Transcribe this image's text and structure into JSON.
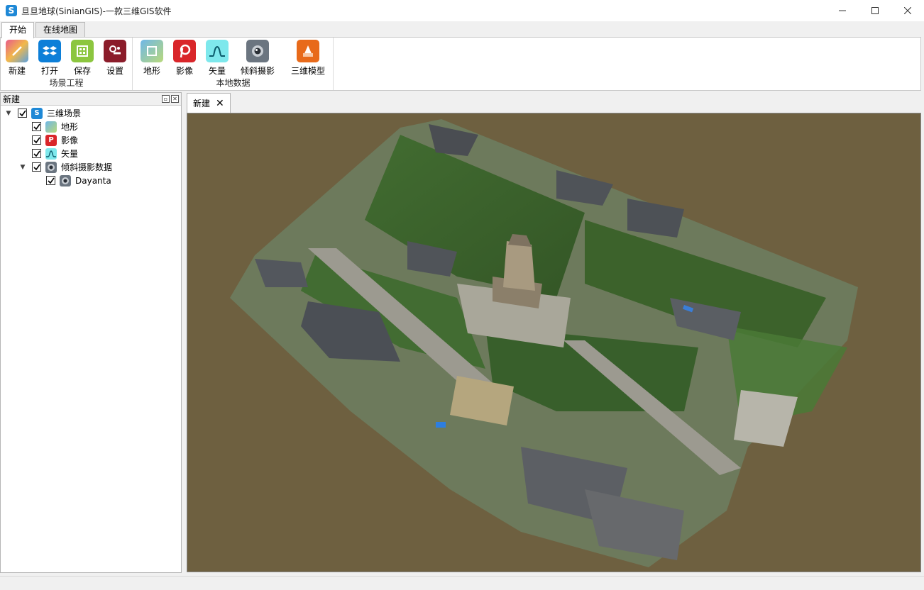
{
  "window": {
    "title": "旦旦地球(SinianGIS)-一款三维GIS软件",
    "app_icon": "S"
  },
  "ribbon_tabs": [
    {
      "label": "开始",
      "active": true
    },
    {
      "label": "在线地图",
      "active": false
    }
  ],
  "ribbon": {
    "groups": [
      {
        "label": "场景工程",
        "buttons": [
          {
            "label": "新建",
            "icon": "new-scene-icon"
          },
          {
            "label": "打开",
            "icon": "open-dropbox-icon"
          },
          {
            "label": "保存",
            "icon": "save-icon"
          },
          {
            "label": "设置",
            "icon": "settings-icon"
          }
        ]
      },
      {
        "label": "本地数据",
        "buttons": [
          {
            "label": "地形",
            "icon": "terrain-icon"
          },
          {
            "label": "影像",
            "icon": "imagery-icon"
          },
          {
            "label": "矢量",
            "icon": "vector-icon"
          },
          {
            "label": "倾斜摄影",
            "icon": "oblique-photo-icon"
          },
          {
            "label": "三维模型",
            "icon": "3d-model-icon"
          }
        ]
      }
    ]
  },
  "left_panel": {
    "title": "新建",
    "tree": [
      {
        "label": "三维场景",
        "level": 0,
        "expanded": true,
        "checked": true,
        "icon": "scene-icon"
      },
      {
        "label": "地形",
        "level": 1,
        "checked": true,
        "icon": "terrain-icon"
      },
      {
        "label": "影像",
        "level": 1,
        "checked": true,
        "icon": "imagery-icon"
      },
      {
        "label": "矢量",
        "level": 1,
        "checked": true,
        "icon": "vector-icon"
      },
      {
        "label": "倾斜摄影数据",
        "level": 1,
        "expanded": true,
        "checked": true,
        "icon": "oblique-photo-icon"
      },
      {
        "label": "Dayanta",
        "level": 2,
        "checked": true,
        "icon": "oblique-photo-icon"
      }
    ]
  },
  "document_tab": {
    "label": "新建",
    "close": "✕"
  },
  "colors": {
    "viewport_background": "#6e6040",
    "accent": "#1e88d6"
  }
}
